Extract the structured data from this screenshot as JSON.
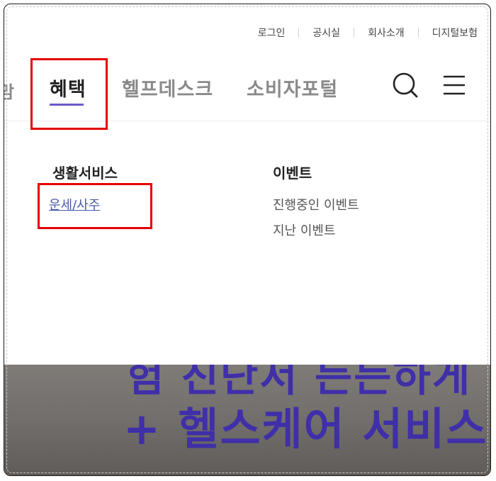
{
  "util_nav": {
    "items": [
      "로그인",
      "공시실",
      "회사소개",
      "디지털보험"
    ]
  },
  "gnb": {
    "partial_prev": "맘",
    "items": [
      {
        "label": "혜택",
        "active": true
      },
      {
        "label": "헬프데스크",
        "active": false
      },
      {
        "label": "소비자포털",
        "active": false
      }
    ],
    "icons": {
      "search": "search-icon",
      "menu": "hamburger-menu-icon"
    },
    "accent_color": "#6a5acd"
  },
  "dropdown": {
    "columns": [
      {
        "title": "생활서비스",
        "links": [
          "운세/사주"
        ],
        "current": "운세/사주"
      },
      {
        "title": "이벤트",
        "links": [
          "진행중인 이벤트",
          "지난 이벤트"
        ]
      }
    ]
  },
  "banner": {
    "line1": "험 진단서 든든하게",
    "line2": "+ 헬스케어 서비스"
  },
  "highlight_color": "#e30000"
}
